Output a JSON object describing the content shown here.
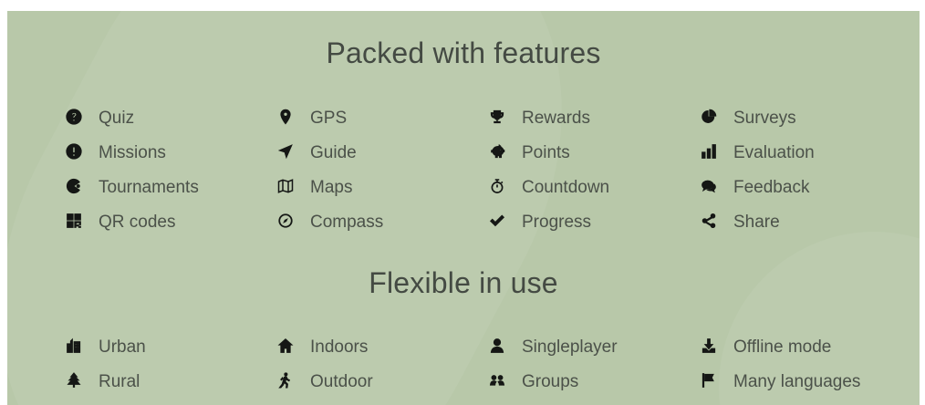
{
  "sections": [
    {
      "title": "Packed with features",
      "items": [
        {
          "label": "Quiz",
          "icon": "question-circle-icon"
        },
        {
          "label": "GPS",
          "icon": "map-marker-icon"
        },
        {
          "label": "Rewards",
          "icon": "trophy-icon"
        },
        {
          "label": "Surveys",
          "icon": "pie-chart-icon"
        },
        {
          "label": "Missions",
          "icon": "exclamation-circle-icon"
        },
        {
          "label": "Guide",
          "icon": "location-arrow-icon"
        },
        {
          "label": "Points",
          "icon": "piggy-bank-icon"
        },
        {
          "label": "Evaluation",
          "icon": "bar-chart-icon"
        },
        {
          "label": "Tournaments",
          "icon": "pacman-icon"
        },
        {
          "label": "Maps",
          "icon": "map-icon"
        },
        {
          "label": "Countdown",
          "icon": "stopwatch-icon"
        },
        {
          "label": "Feedback",
          "icon": "comments-icon"
        },
        {
          "label": "QR codes",
          "icon": "qrcode-icon"
        },
        {
          "label": "Compass",
          "icon": "compass-icon"
        },
        {
          "label": "Progress",
          "icon": "check-icon"
        },
        {
          "label": "Share",
          "icon": "share-alt-icon"
        }
      ]
    },
    {
      "title": "Flexible in use",
      "items": [
        {
          "label": "Urban",
          "icon": "city-icon"
        },
        {
          "label": "Indoors",
          "icon": "home-icon"
        },
        {
          "label": "Singleplayer",
          "icon": "user-icon"
        },
        {
          "label": "Offline mode",
          "icon": "download-icon"
        },
        {
          "label": "Rural",
          "icon": "tree-icon"
        },
        {
          "label": "Outdoor",
          "icon": "walking-icon"
        },
        {
          "label": "Groups",
          "icon": "users-icon"
        },
        {
          "label": "Many languages",
          "icon": "flag-icon"
        }
      ]
    }
  ],
  "colors": {
    "background": "#b8c8a9",
    "title": "#444a43",
    "text": "#4b5149",
    "icon": "#151715"
  }
}
